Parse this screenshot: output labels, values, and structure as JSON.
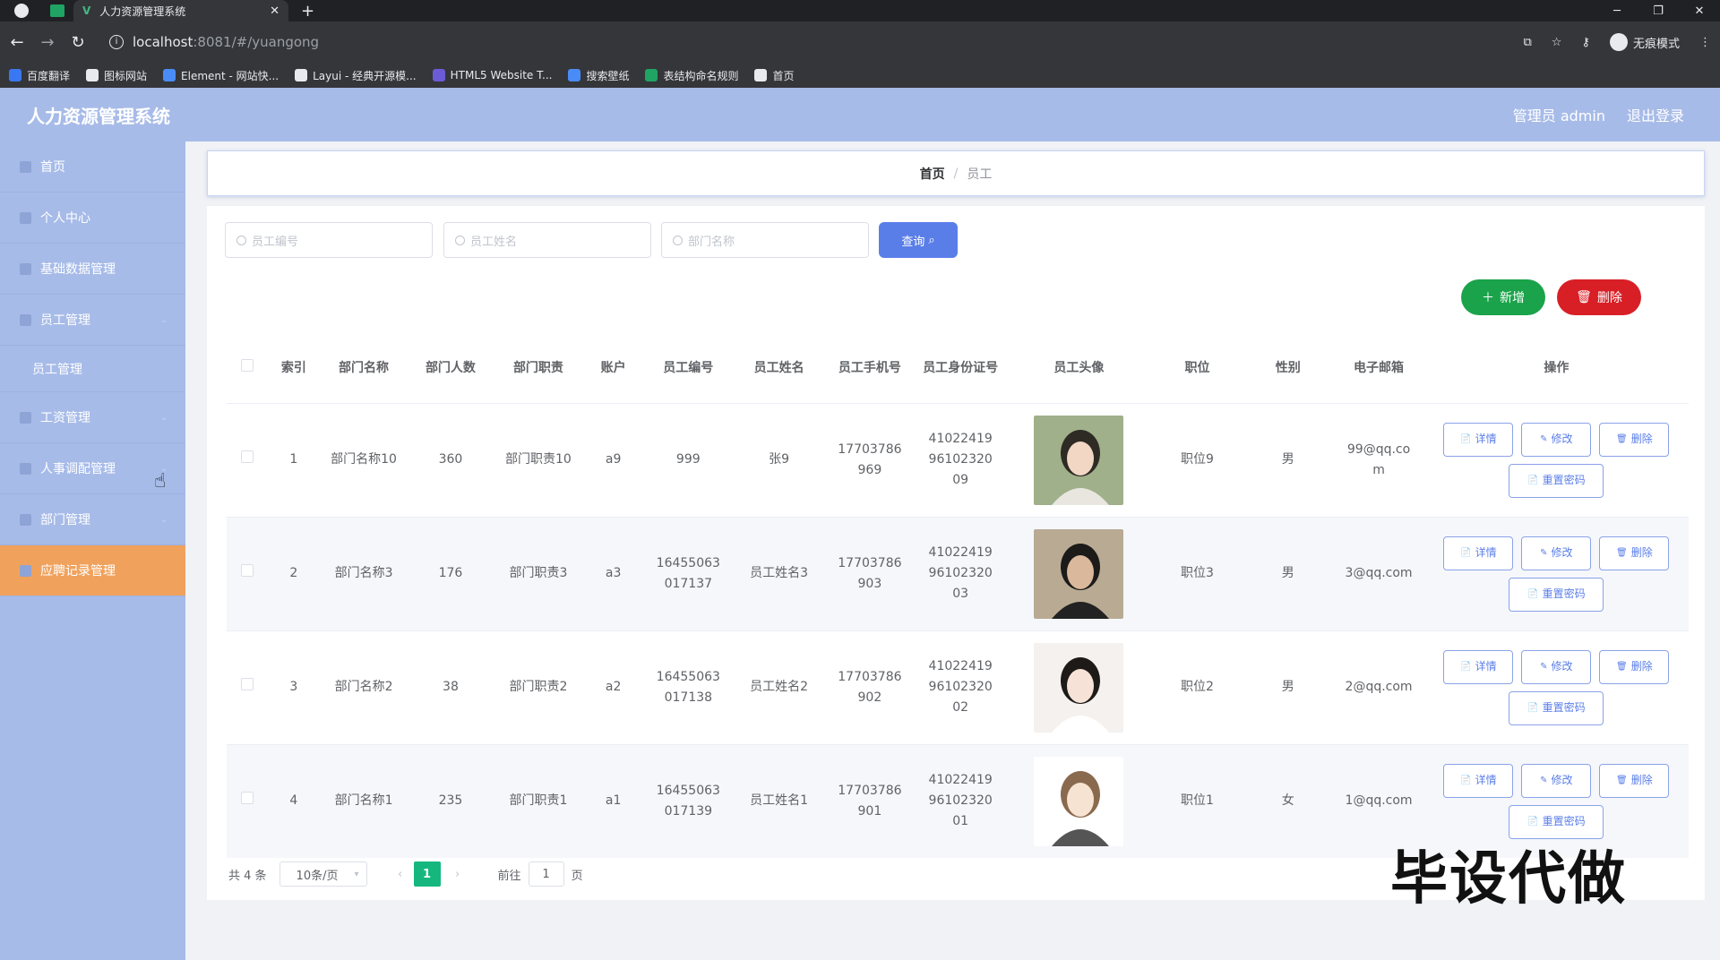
{
  "browser": {
    "tab_title": "人力资源管理系统",
    "tab_close": "✕",
    "new_tab": "+",
    "url_host": "localhost",
    "url_path": ":8081/#/yuangong",
    "incognito_label": "无痕模式",
    "bookmarks": [
      "百度翻译",
      "图标网站",
      "Element - 网站快...",
      "Layui - 经典开源模...",
      "HTML5 Website T...",
      "搜索壁纸",
      "表结构命名规则",
      "首页"
    ],
    "bookmark_colors": [
      "#3a78f2",
      "#e8eaed",
      "#4a8cf7",
      "#e8eaed",
      "#6b5bd6",
      "#4a8cf7",
      "#1fa463",
      "#e8eaed"
    ]
  },
  "app": {
    "title": "人力资源管理系统",
    "user_label": "管理员 admin",
    "logout": "退出登录"
  },
  "sidebar": {
    "items": [
      {
        "label": "首页"
      },
      {
        "label": "个人中心"
      },
      {
        "label": "基础数据管理"
      },
      {
        "label": "员工管理"
      },
      {
        "label": "员工管理",
        "sub": true
      },
      {
        "label": "工资管理"
      },
      {
        "label": "人事调配管理"
      },
      {
        "label": "部门管理"
      },
      {
        "label": "应聘记录管理",
        "active": true
      }
    ]
  },
  "breadcrumb": {
    "home": "首页",
    "sep": "/",
    "current": "员工"
  },
  "search": {
    "employee_no_placeholder": "员工编号",
    "employee_name_placeholder": "员工姓名",
    "department_placeholder": "部门名称",
    "query_button": "查询"
  },
  "actions": {
    "add": "新增",
    "delete": "删除"
  },
  "table": {
    "headers": [
      "索引",
      "部门名称",
      "部门人数",
      "部门职责",
      "账户",
      "员工编号",
      "员工姓名",
      "员工手机号",
      "员工身份证号",
      "员工头像",
      "职位",
      "性别",
      "电子邮箱",
      "操作"
    ],
    "op_labels": {
      "detail": "详情",
      "edit": "修改",
      "delete": "删除",
      "reset": "重置密码"
    },
    "rows": [
      {
        "index": "1",
        "dept": "部门名称10",
        "count": "360",
        "duty": "部门职责10",
        "account": "a9",
        "emp_no": "999",
        "name": "张9",
        "phone": "17703786969",
        "idcard": "410224199610232009",
        "avatar": "avatar-woman-profile",
        "position": "职位9",
        "gender": "男",
        "email": "99@qq.com"
      },
      {
        "index": "2",
        "dept": "部门名称3",
        "count": "176",
        "duty": "部门职责3",
        "account": "a3",
        "emp_no": "16455063017137",
        "name": "员工姓名3",
        "phone": "17703786903",
        "idcard": "410224199610232003",
        "avatar": "avatar-man-gallery",
        "position": "职位3",
        "gender": "男",
        "email": "3@qq.com"
      },
      {
        "index": "3",
        "dept": "部门名称2",
        "count": "38",
        "duty": "部门职责2",
        "account": "a2",
        "emp_no": "16455063017138",
        "name": "员工姓名2",
        "phone": "17703786902",
        "idcard": "410224199610232002",
        "avatar": "avatar-woman-portrait",
        "position": "职位2",
        "gender": "男",
        "email": "2@qq.com"
      },
      {
        "index": "4",
        "dept": "部门名称1",
        "count": "235",
        "duty": "部门职责1",
        "account": "a1",
        "emp_no": "16455063017139",
        "name": "员工姓名1",
        "phone": "17703786901",
        "idcard": "410224199610232001",
        "avatar": "avatar-cartoon-girl",
        "position": "职位1",
        "gender": "女",
        "email": "1@qq.com"
      }
    ]
  },
  "pagination": {
    "total": "共 4 条",
    "page_size": "10条/页",
    "current": "1",
    "goto_prefix": "前往",
    "goto_value": "1",
    "goto_suffix": "页"
  },
  "watermark": "毕设代做",
  "colors": {
    "header_bg": "#a7bbe8",
    "active_menu": "#f0a25d",
    "primary": "#5a7ee8",
    "success": "#1aa34a",
    "danger": "#d91f26",
    "page_active": "#16b77f"
  }
}
